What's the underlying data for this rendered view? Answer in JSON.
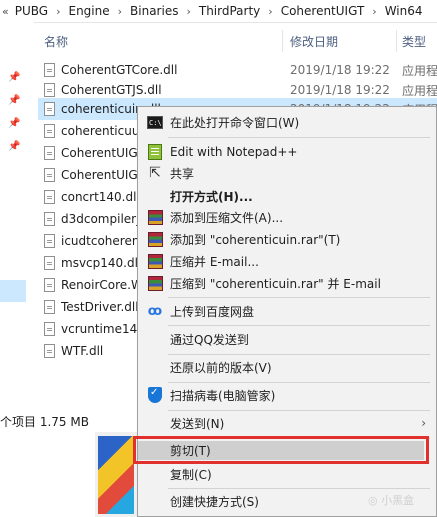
{
  "breadcrumb": {
    "back": "«",
    "items": [
      "PUBG",
      "Engine",
      "Binaries",
      "ThirdParty",
      "CoherentUIGT",
      "Win64"
    ]
  },
  "columns": {
    "name": "名称",
    "date": "修改日期",
    "type": "类型"
  },
  "files": [
    {
      "name": "CoherentGTCore.dll",
      "date": "2019/1/18 19:22",
      "type": "应用程"
    },
    {
      "name": "CoherentGTJS.dll",
      "date": "2019/1/18 19:22",
      "type": "应用程"
    },
    {
      "name": "coherenticuin.dll",
      "date": "2019/1/18 19:22",
      "type": "应用程"
    },
    {
      "name": "coherenticuuc",
      "date": "",
      "type": ""
    },
    {
      "name": "CoherentUIGT",
      "date": "",
      "type": ""
    },
    {
      "name": "CoherentUIGT",
      "date": "",
      "type": ""
    },
    {
      "name": "concrt140.dll",
      "date": "",
      "type": ""
    },
    {
      "name": "d3dcompiler_",
      "date": "",
      "type": ""
    },
    {
      "name": "icudtcoherent",
      "date": "",
      "type": ""
    },
    {
      "name": "msvcp140.dll",
      "date": "",
      "type": ""
    },
    {
      "name": "RenoirCore.W",
      "date": "",
      "type": ""
    },
    {
      "name": "TestDriver.dll",
      "date": "",
      "type": ""
    },
    {
      "name": "vcruntime140",
      "date": "",
      "type": ""
    },
    {
      "name": "WTF.dll",
      "date": "",
      "type": ""
    }
  ],
  "status": {
    "text": "个项目  1.75 MB"
  },
  "context_menu": {
    "items": [
      {
        "label": "在此处打开命令窗口(W)",
        "icon": "cmd-icon"
      },
      {
        "label": "Edit with Notepad++",
        "icon": "notepad-plus-plus-icon"
      },
      {
        "label": "共享",
        "icon": "share-icon"
      },
      {
        "label": "打开方式(H)...",
        "icon": ""
      },
      {
        "label": "添加到压缩文件(A)...",
        "icon": "winrar-icon"
      },
      {
        "label": "添加到 \"coherenticuin.rar\"(T)",
        "icon": "winrar-icon"
      },
      {
        "label": "压缩并 E-mail...",
        "icon": "winrar-icon"
      },
      {
        "label": "压缩到 \"coherenticuin.rar\" 并 E-mail",
        "icon": "winrar-icon"
      },
      {
        "label": "上传到百度网盘",
        "icon": "baidu-netdisk-icon"
      },
      {
        "label": "通过QQ发送到",
        "icon": ""
      },
      {
        "label": "还原以前的版本(V)",
        "icon": ""
      },
      {
        "label": "扫描病毒(电脑管家)",
        "icon": "shield-icon"
      },
      {
        "label": "发送到(N)",
        "icon": ""
      },
      {
        "label": "剪切(T)",
        "icon": ""
      },
      {
        "label": "复制(C)",
        "icon": ""
      },
      {
        "label": "创建快捷方式(S)",
        "icon": ""
      }
    ],
    "submenu_arrow": "›"
  },
  "colors": {
    "selection": "#cce8ff",
    "highlight_border": "#e0312f",
    "menu_bg": "#f2f2f2"
  }
}
